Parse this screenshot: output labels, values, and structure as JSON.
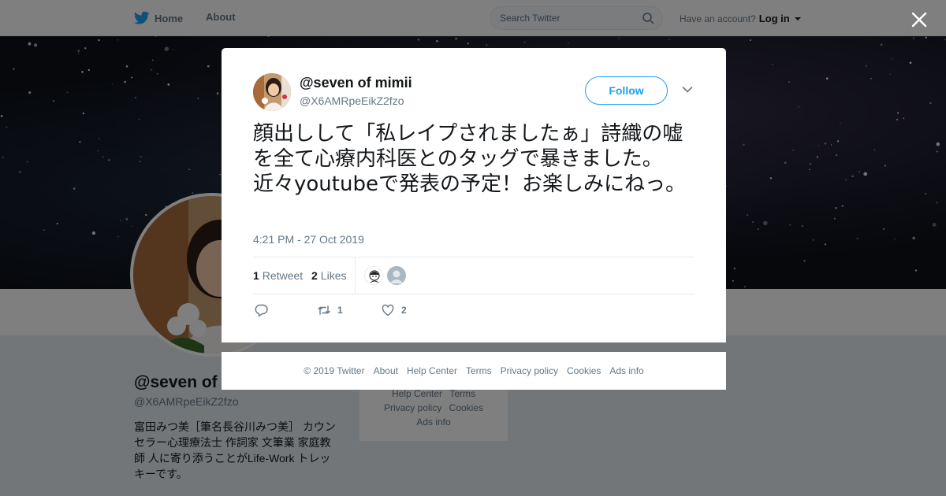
{
  "topbar": {
    "home_label": "Home",
    "about_label": "About",
    "search_placeholder": "Search Twitter",
    "account_prompt": "Have an account?",
    "login_label": "Log in"
  },
  "profile": {
    "name": "@seven of mimii",
    "handle": "@X6AMRpeEikZ2fzo",
    "bio": "富田みつ美［筆名長谷川みつ美］ カウンセラー心理療法士 作詞家 文筆業 家庭教師 人に寄り添うことがLife-Work トレッキーです。"
  },
  "side_footer": {
    "row1": [
      "Help Center",
      "Terms"
    ],
    "row2": [
      "Privacy policy",
      "Cookies"
    ],
    "row3": [
      "Ads info"
    ]
  },
  "tweet": {
    "author_name": "@seven of mimii",
    "author_handle": "@X6AMRpeEikZ2fzo",
    "follow_label": "Follow",
    "text": "顔出しして「私レイプされましたぁ」詩織の嘘を全て心療内科医とのタッグで暴きました。近々youtubeで発表の予定！お楽しみにねっ。",
    "timestamp": "4:21 PM - 27 Oct 2019",
    "retweet_count": "1",
    "retweet_label": "Retweet",
    "like_count": "2",
    "like_label": "Likes",
    "action_retweet_count": "1",
    "action_like_count": "2"
  },
  "footer": {
    "copyright": "© 2019 Twitter",
    "about": "About",
    "help_center": "Help Center",
    "terms": "Terms",
    "privacy": "Privacy policy",
    "cookies": "Cookies",
    "ads_info": "Ads info"
  },
  "colors": {
    "brand_blue": "#1da1f2",
    "muted_text": "#657786",
    "overlay": "rgba(0,0,0,0.5)"
  },
  "icons": [
    "twitter-bird-icon",
    "search-icon",
    "close-icon",
    "chevron-down-icon",
    "reply-icon",
    "retweet-icon",
    "heart-icon"
  ]
}
